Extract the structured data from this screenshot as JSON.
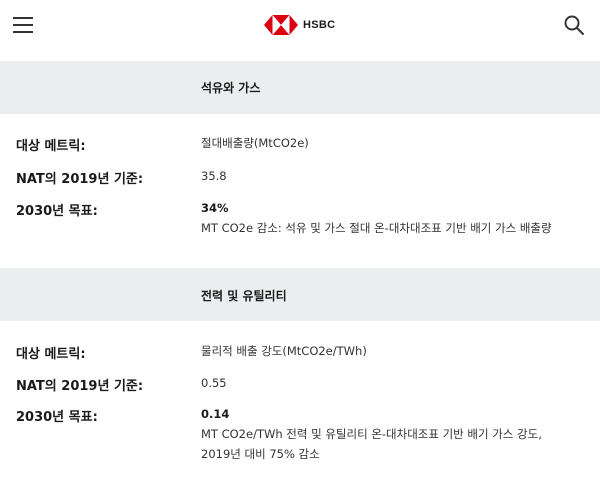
{
  "header": {
    "menu_icon": "hamburger-menu-icon",
    "logo_text": "HSBC",
    "search_icon": "search-icon",
    "brand_color": "#db0011"
  },
  "sections": [
    {
      "title": "석유와 가스",
      "rows": [
        {
          "label": "대상 메트릭:",
          "value": "절대배출량(MtCO2e)"
        },
        {
          "label": "NAT의 2019년 기준:",
          "value": "35.8"
        },
        {
          "label": "2030년 목표:",
          "value_bold": "34%",
          "value": "MT CO2e 감소: 석유 및 가스 절대 온-대차대조표 기반 배기 가스 배출량"
        }
      ]
    },
    {
      "title": "전력 및 유틸리티",
      "rows": [
        {
          "label": "대상 메트릭:",
          "value": "물리적 배출 강도(MtCO2e/TWh)"
        },
        {
          "label": "NAT의 2019년 기준:",
          "value": "0.55"
        },
        {
          "label": "2030년 목표:",
          "value_bold": "0.14",
          "value": "MT CO2e/TWh 전력 및 유틸리티 온-대차대조표 기반 배기 가스 강도,",
          "value_line2": "2019년 대비 75% 감소"
        }
      ]
    }
  ]
}
